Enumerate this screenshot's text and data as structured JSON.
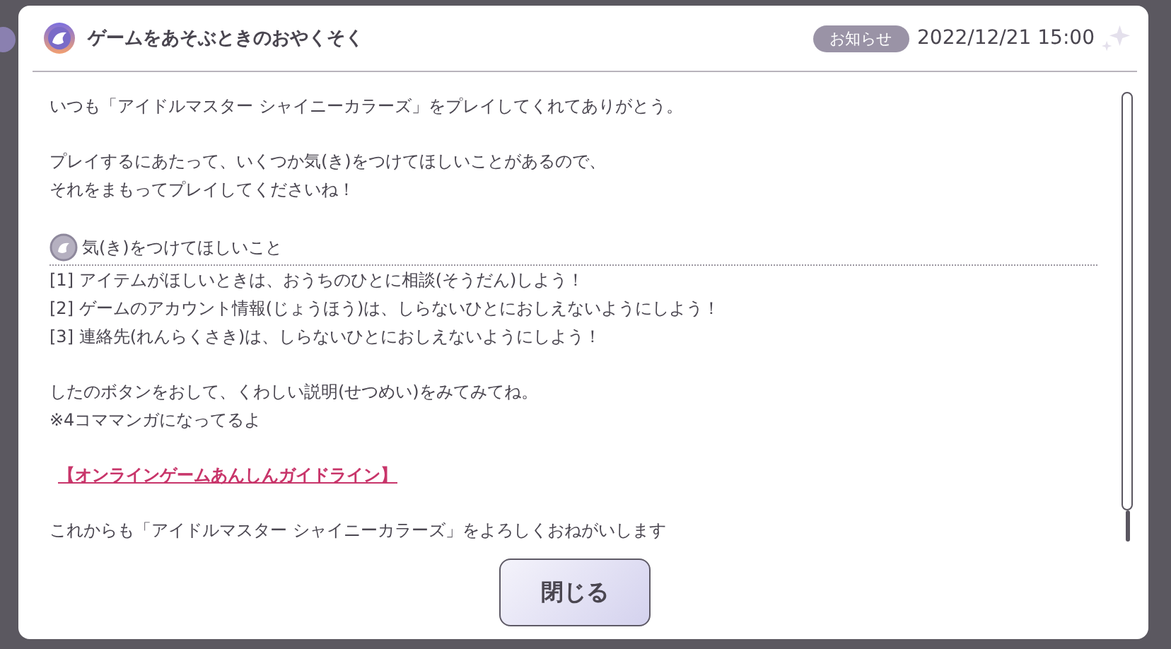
{
  "dialog": {
    "title": "ゲームをあそぶときのおやくそく",
    "tag": "お知らせ",
    "date": "2022/12/21 15:00",
    "body": [
      {
        "kind": "text",
        "text": "いつも「アイドルマスター シャイニーカラーズ」をプレイしてくれてありがとう。"
      },
      {
        "kind": "gap"
      },
      {
        "kind": "text",
        "text": "プレイするにあたって、いくつか気(き)をつけてほしいことがあるので、"
      },
      {
        "kind": "text",
        "text": "それをまもってプレイしてくださいね！"
      },
      {
        "kind": "gap"
      },
      {
        "kind": "heading",
        "text": "気(き)をつけてほしいこと"
      },
      {
        "kind": "text",
        "text": "[1] アイテムがほしいときは、おうちのひとに相談(そうだん)しよう！"
      },
      {
        "kind": "text",
        "text": "[2] ゲームのアカウント情報(じょうほう)は、しらないひとにおしえないようにしよう！"
      },
      {
        "kind": "text",
        "text": "[3] 連絡先(れんらくさき)は、しらないひとにおしえないようにしよう！"
      },
      {
        "kind": "gap"
      },
      {
        "kind": "text",
        "text": "したのボタンをおして、くわしい説明(せつめい)をみてみてね。"
      },
      {
        "kind": "text",
        "text": "※4コママンガになってるよ"
      },
      {
        "kind": "gap"
      },
      {
        "kind": "link",
        "text": "【オンラインゲームあんしんガイドライン】"
      },
      {
        "kind": "gap"
      },
      {
        "kind": "text",
        "text": "これからも「アイドルマスター シャイニーカラーズ」をよろしくおねがいします"
      }
    ],
    "close_button": "閉じる"
  }
}
